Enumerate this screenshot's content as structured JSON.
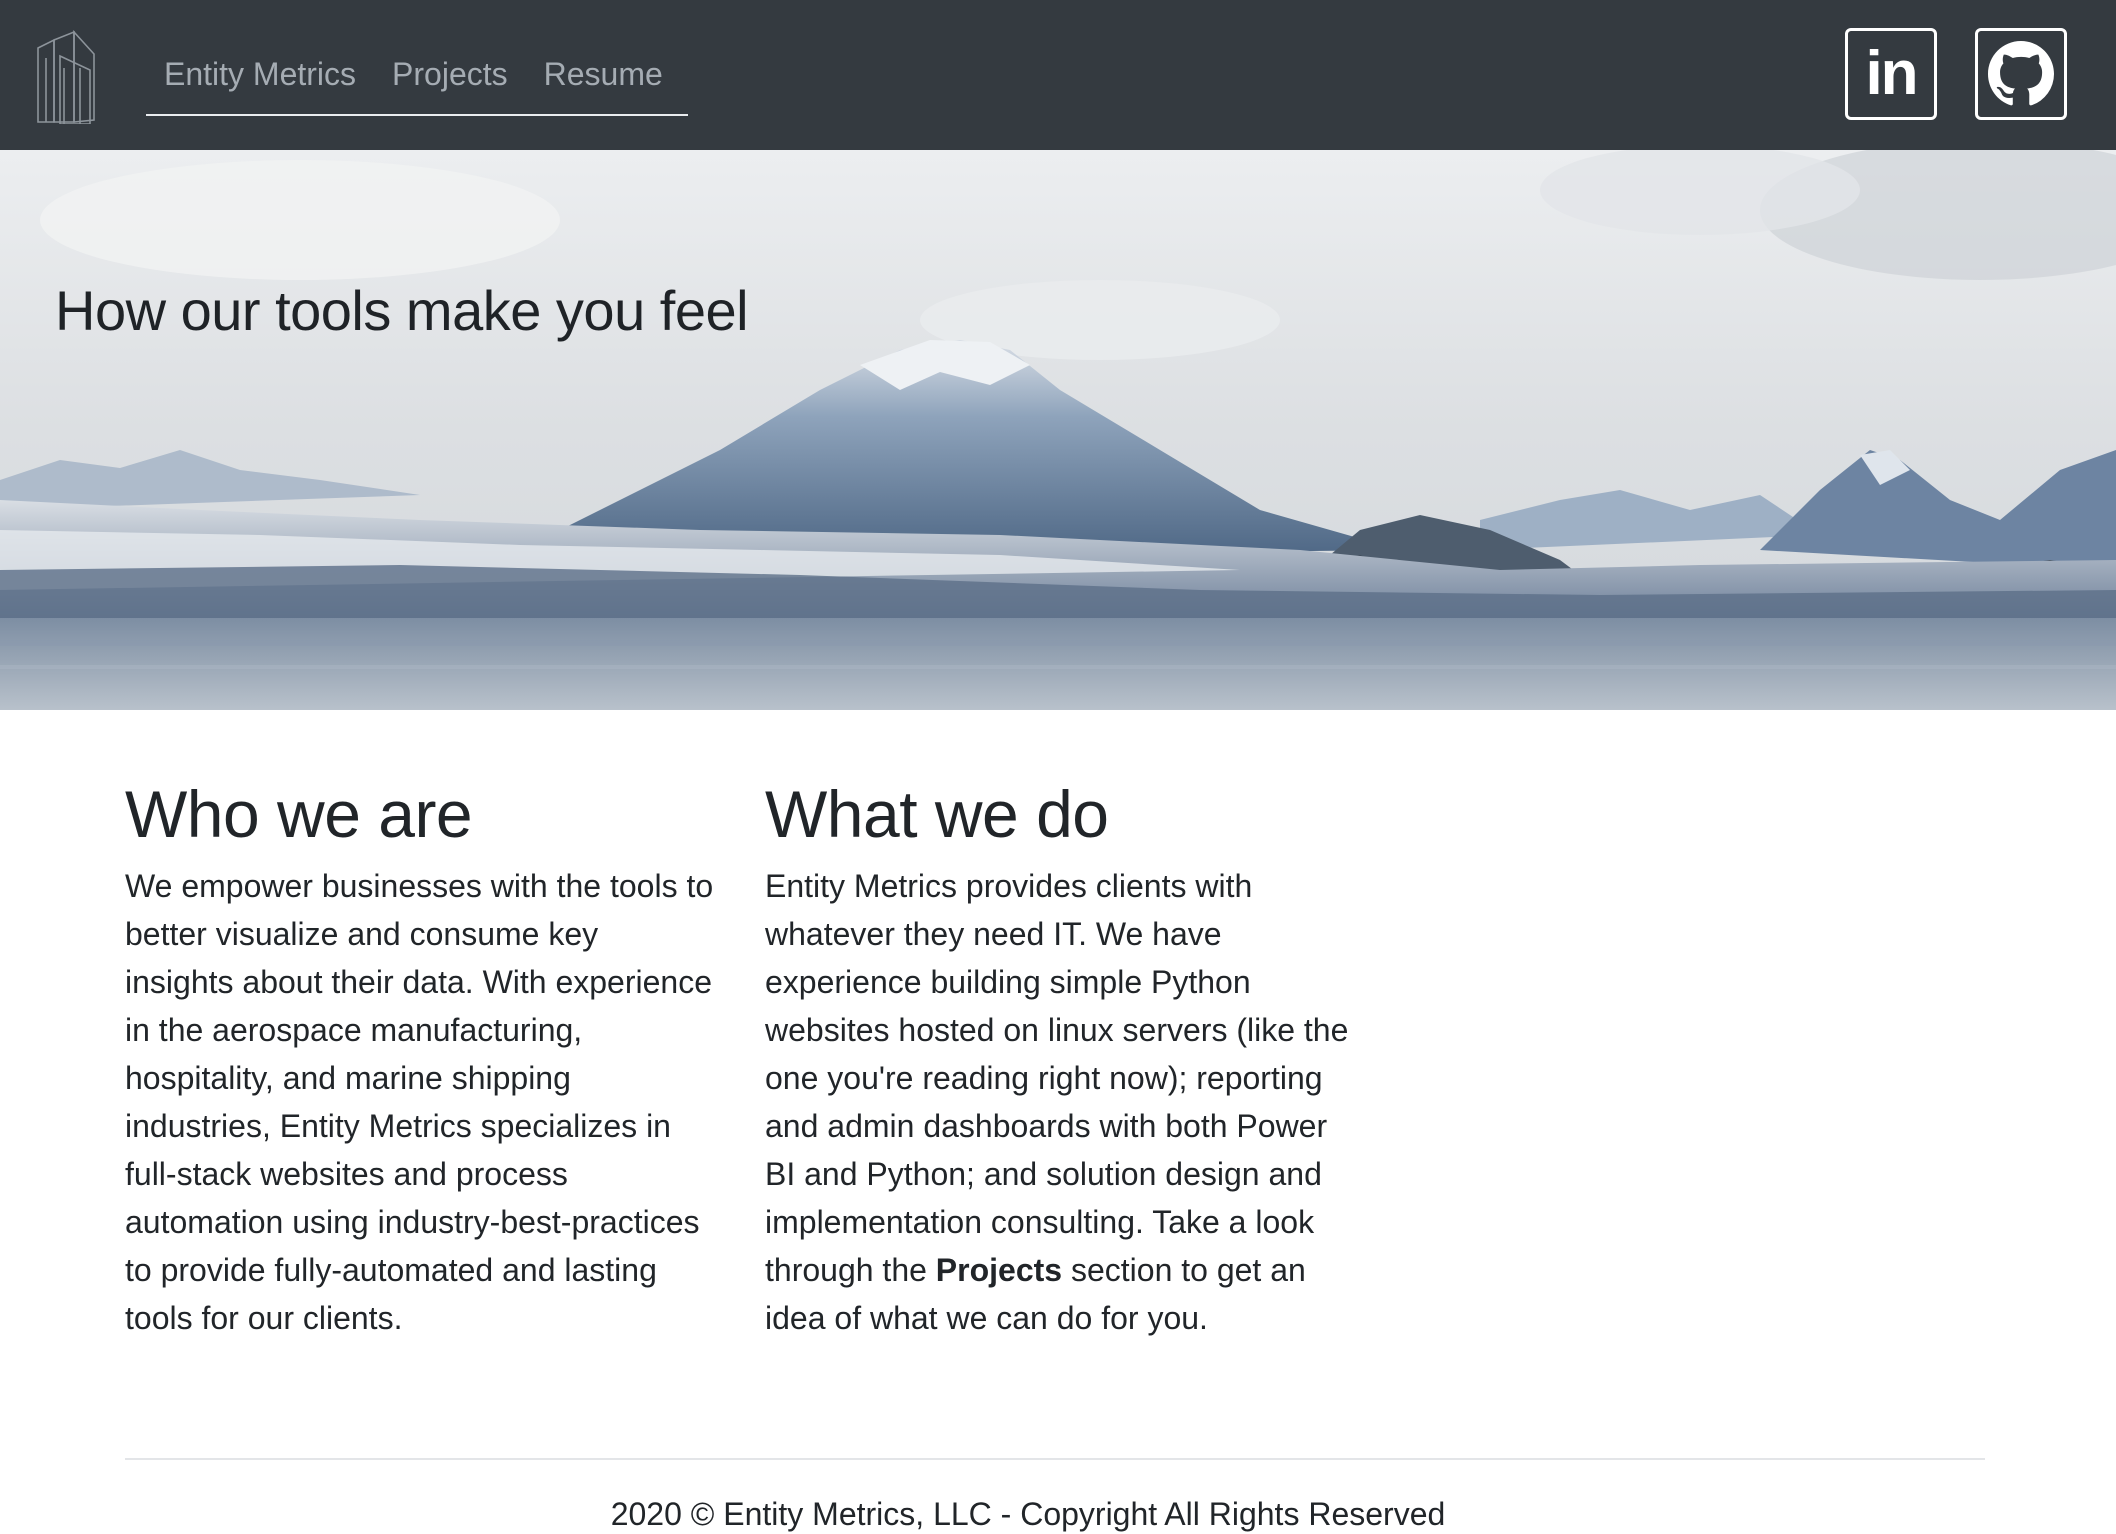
{
  "nav": {
    "links": [
      "Entity Metrics",
      "Projects",
      "Resume"
    ],
    "linkedin_label": "in"
  },
  "hero": {
    "title": "How our tools make you feel"
  },
  "who": {
    "heading": "Who we are",
    "body": "We empower businesses with the tools to better visualize and consume key insights about their data. With experience in the aerospace manufacturing, hospitality, and marine shipping industries, Entity Metrics specializes in full-stack websites and process automation using industry-best-practices to provide fully-automated and lasting tools for our clients."
  },
  "what": {
    "heading": "What we do",
    "body_before": "Entity Metrics provides clients with whatever they need IT. We have experience building simple Python websites hosted on linux servers (like the one you're reading right now); reporting and admin dashboards with both Power BI and Python; and solution design and implementation consulting. Take a look through the ",
    "body_link": "Projects",
    "body_after": " section to get an idea of what we can do for you."
  },
  "footer": {
    "text": "2020 © Entity Metrics, LLC - Copyright All Rights Reserved"
  },
  "colors": {
    "navbar_bg": "#343a40",
    "nav_link": "#a5acb3",
    "text": "#212529"
  },
  "icons": [
    "buildings-logo-icon",
    "linkedin-icon",
    "github-icon"
  ]
}
